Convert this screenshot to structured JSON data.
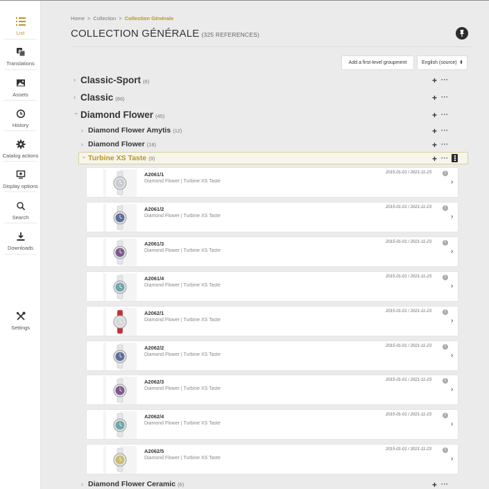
{
  "sidebar": {
    "items": [
      {
        "label": "List",
        "icon": "list-icon",
        "active": true
      },
      {
        "label": "Translations",
        "icon": "translations-icon"
      },
      {
        "label": "Assets",
        "icon": "image-icon"
      },
      {
        "label": "History",
        "icon": "history-icon"
      },
      {
        "label": "Catalog actions",
        "icon": "gear-icon"
      },
      {
        "label": "Display options",
        "icon": "display-icon"
      },
      {
        "label": "Search",
        "icon": "search-icon"
      },
      {
        "label": "Downloads",
        "icon": "download-icon"
      },
      {
        "label": "Settings",
        "icon": "wrench-icon"
      }
    ]
  },
  "breadcrumb": {
    "home": "Home",
    "sep": ">",
    "collection": "Collection",
    "current": "Collection Générale"
  },
  "page": {
    "title": "COLLECTION GÉNÉRALE",
    "count": "(325 REFERENCES)"
  },
  "toolbar": {
    "add_label": "Add a first-level groupment",
    "language": "English (source)",
    "language_caret": "⬍"
  },
  "tree": {
    "r1": {
      "name": "Classic-Sport",
      "count": "(6)"
    },
    "r2": {
      "name": "Classic",
      "count": "(86)"
    },
    "r3": {
      "name": "Diamond Flower",
      "count": "(45)"
    },
    "r4": {
      "name": "Diamond Flower Amytis",
      "count": "(12)"
    },
    "r5": {
      "name": "Diamond Flower",
      "count": "(18)"
    },
    "r6": {
      "name": "Turbine XS Taste",
      "count": "(9)"
    },
    "r7": {
      "name": "Diamond Flower Ceramic",
      "count": "(6)"
    }
  },
  "actions": {
    "plus": "+",
    "dots": "···",
    "chev_right": "›",
    "chev_down": "⌄",
    "arrow": "›",
    "info": "!"
  },
  "products": [
    {
      "code": "A2061/1",
      "path": "Diamond Flower | Turbine XS Taste",
      "dates": "2015-01-01 / 2021-11-23",
      "dial": "#c9ccd2",
      "strap": "#e4e6ea"
    },
    {
      "code": "A2061/2",
      "path": "Diamond Flower | Turbine XS Taste",
      "dates": "2015-01-01 / 2021-11-23",
      "dial": "#5b6f9a",
      "strap": "#e4e6ea"
    },
    {
      "code": "A2061/3",
      "path": "Diamond Flower | Turbine XS Taste",
      "dates": "2015-01-01 / 2021-11-23",
      "dial": "#7d5a8c",
      "strap": "#e4e6ea"
    },
    {
      "code": "A2061/4",
      "path": "Diamond Flower | Turbine XS Taste",
      "dates": "2015-01-01 / 2021-11-23",
      "dial": "#6fa5ad",
      "strap": "#e4e6ea"
    },
    {
      "code": "A2062/1",
      "path": "Diamond Flower | Turbine XS Taste",
      "dates": "2015-01-01 / 2021-11-23",
      "dial": "#d8d8da",
      "strap": "#c0303a"
    },
    {
      "code": "A2062/2",
      "path": "Diamond Flower | Turbine XS Taste",
      "dates": "2015-01-01 / 2021-11-23",
      "dial": "#5b6f9a",
      "strap": "#e4e6ea"
    },
    {
      "code": "A2062/3",
      "path": "Diamond Flower | Turbine XS Taste",
      "dates": "2015-01-01 / 2021-11-23",
      "dial": "#7d5a8c",
      "strap": "#e4e6ea"
    },
    {
      "code": "A2062/4",
      "path": "Diamond Flower | Turbine XS Taste",
      "dates": "2015-01-01 / 2021-11-23",
      "dial": "#6fa5ad",
      "strap": "#e4e6ea"
    },
    {
      "code": "A2062/5",
      "path": "Diamond Flower | Turbine XS Taste",
      "dates": "2015-01-01 / 2021-11-23",
      "dial": "#cdbb6e",
      "strap": "#e4e6ea"
    }
  ]
}
